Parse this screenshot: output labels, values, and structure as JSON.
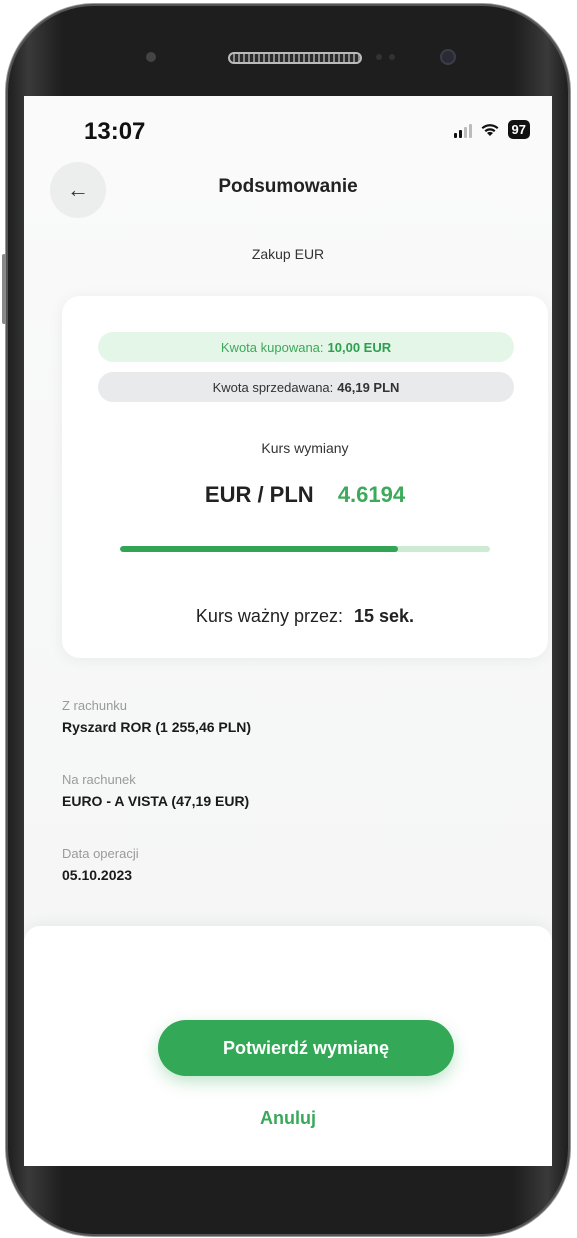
{
  "status_bar": {
    "time": "13:07",
    "battery": "97"
  },
  "header": {
    "title": "Podsumowanie"
  },
  "subtitle": "Zakup EUR",
  "summary_card": {
    "bought_label": "Kwota kupowana:",
    "bought_value": "10,00 EUR",
    "sold_label": "Kwota sprzedawana:",
    "sold_value": "46,19 PLN",
    "rate_label": "Kurs wymiany",
    "rate_pair": "EUR / PLN",
    "rate_value": "4.6194",
    "rate_validity_progress": 0.75,
    "validity_label": "Kurs ważny przez:",
    "validity_value": "15 sek."
  },
  "details": [
    {
      "label": "Z rachunku",
      "value": "Ryszard ROR (1 255,46 PLN)"
    },
    {
      "label": "Na rachunek",
      "value": "EURO - A VISTA (47,19 EUR)"
    },
    {
      "label": "Data operacji",
      "value": "05.10.2023"
    }
  ],
  "actions": {
    "confirm": "Potwierdź wymianę",
    "cancel": "Anuluj"
  },
  "colors": {
    "accent": "#33a857",
    "accent_light": "#e4f6e7",
    "pill_grey": "#e8eaec"
  },
  "icons": {
    "back": "arrow-left-icon",
    "wifi": "wifi-icon",
    "signal": "signal-icon",
    "battery": "battery-icon"
  }
}
